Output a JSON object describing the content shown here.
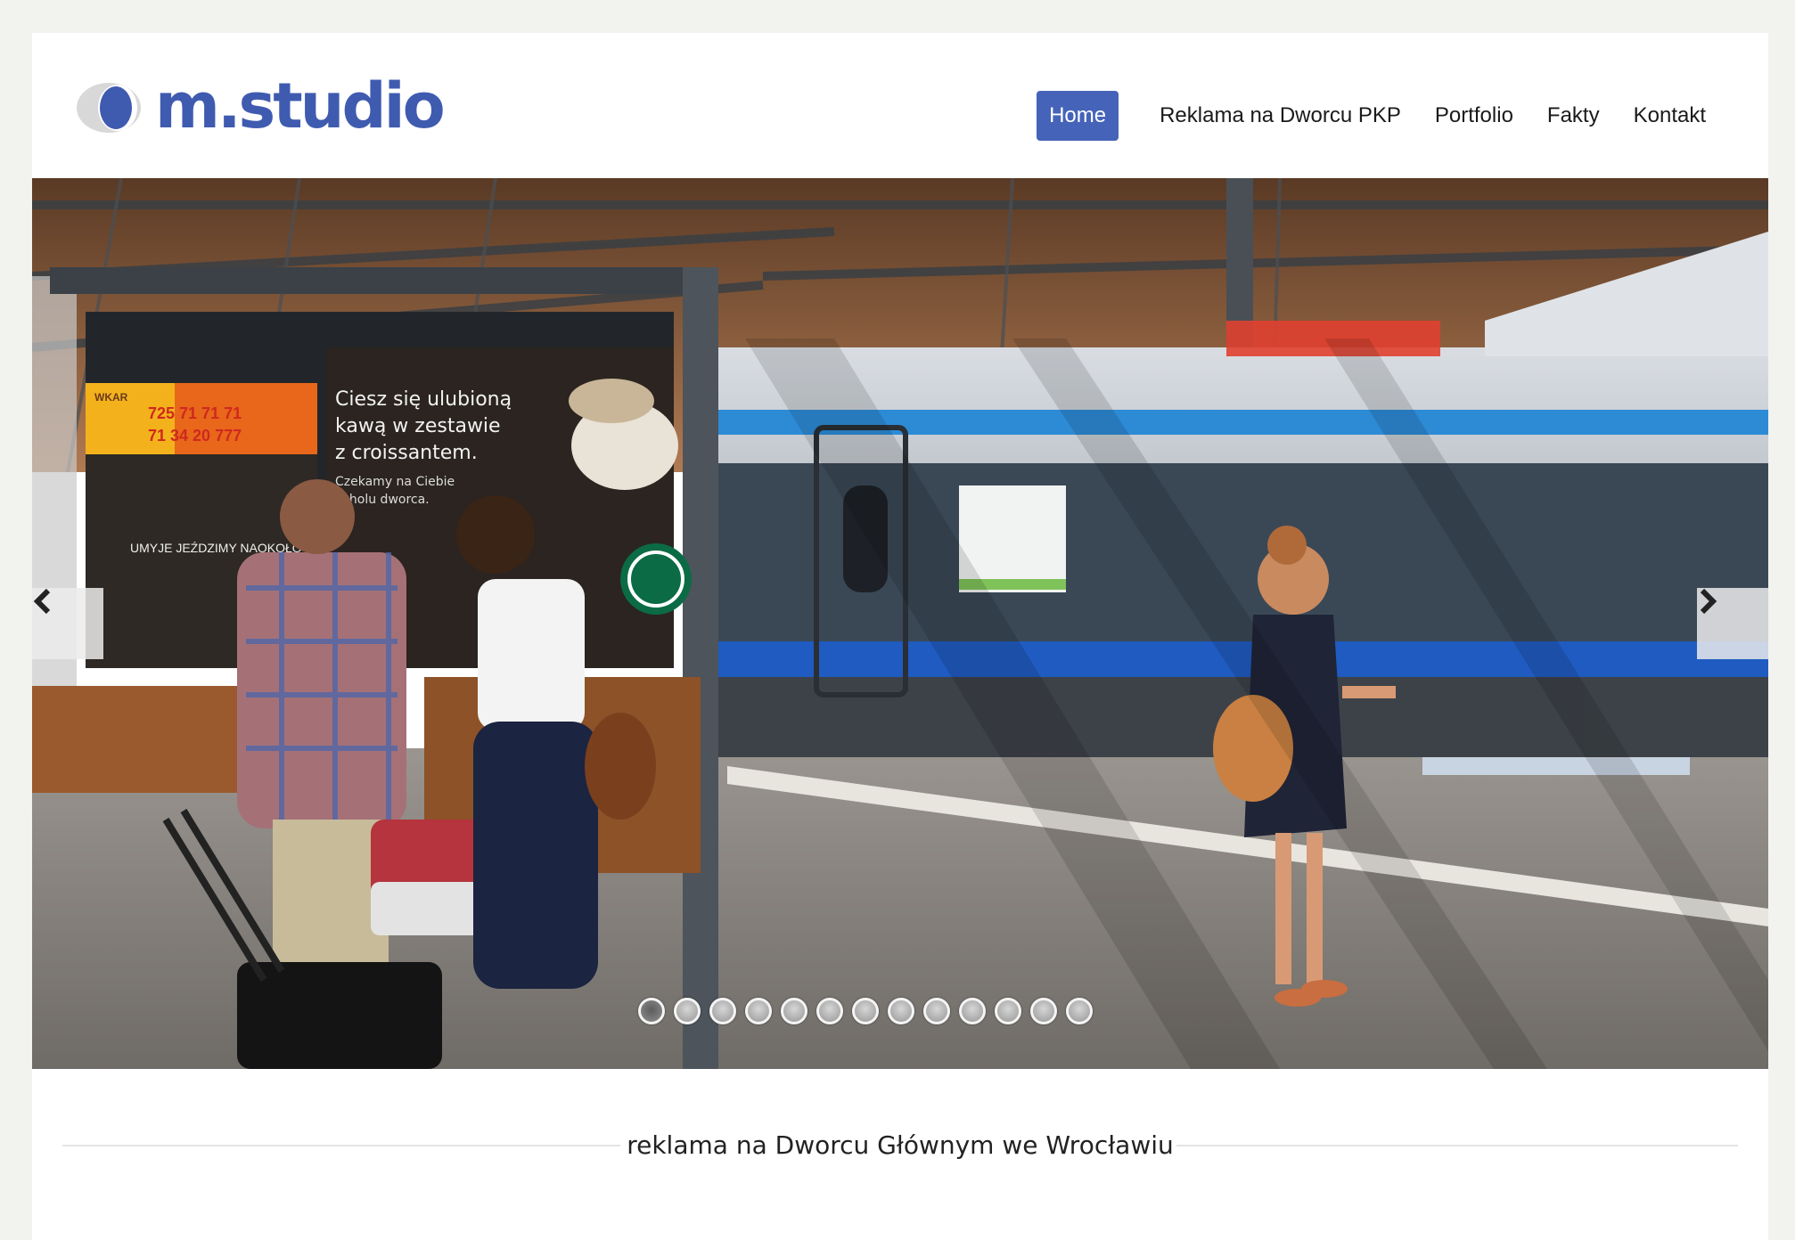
{
  "header": {
    "logo_text": "m.studio",
    "brand_color": "#3f5bb0"
  },
  "nav": {
    "items": [
      {
        "label": "Home",
        "active": true
      },
      {
        "label": "Reklama na Dworcu PKP",
        "active": false
      },
      {
        "label": "Portfolio",
        "active": false
      },
      {
        "label": "Fakty",
        "active": false
      },
      {
        "label": "Kontakt",
        "active": false
      }
    ],
    "active_color": "#4563b8"
  },
  "slider": {
    "prev_icon": "chevron-left-icon",
    "next_icon": "chevron-right-icon",
    "slide_count": 13,
    "active_index": 0,
    "ads": {
      "phone_1": "725 71 71 71",
      "phone_2": "71 34 20 777",
      "left_brand": "WKAR",
      "left_slogan": "UMYJE JEŹDZIMY NAOKOŁO",
      "coffee_line_1": "Ciesz się ulubioną",
      "coffee_line_2": "kawą w zestawie",
      "coffee_line_3": "z croissantem.",
      "coffee_line_4": "Czekamy na Ciebie",
      "coffee_line_5": "w holu dworca."
    }
  },
  "section": {
    "heading": "reklama na Dworcu Głównym we Wrocławiu"
  }
}
